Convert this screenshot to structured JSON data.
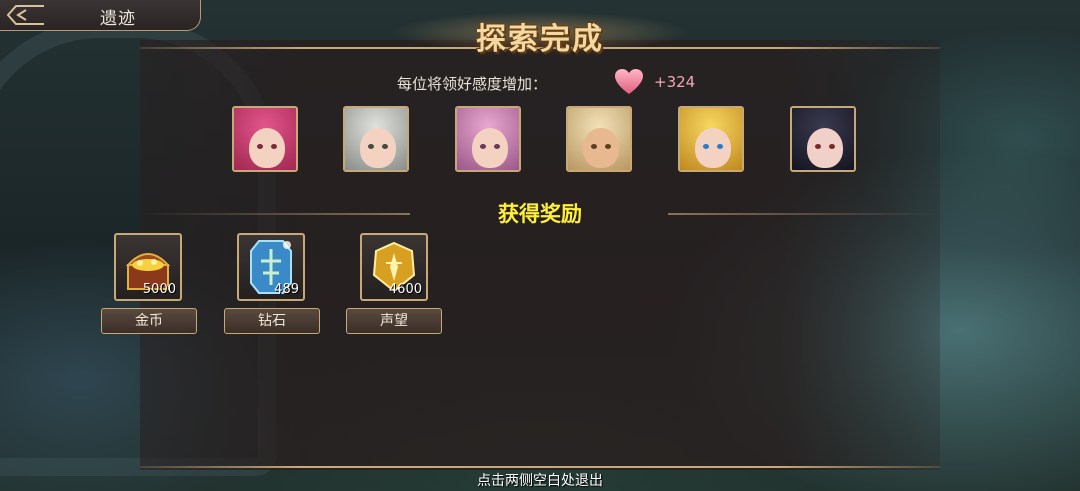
{
  "header": {
    "back_title": "遗迹",
    "title": "探索完成"
  },
  "affinity": {
    "label": "每位将领好感度增加：",
    "icon": "heart-icon",
    "value": "+324"
  },
  "portraits": [
    {
      "name": "portrait-1",
      "hair": "#e3558c",
      "eye": "#7a2a3a"
    },
    {
      "name": "portrait-2",
      "hair": "#c9ccc8",
      "eye": "#4a4a3a"
    },
    {
      "name": "portrait-3",
      "hair": "#d98fbf",
      "eye": "#6a3a5a"
    },
    {
      "name": "portrait-4",
      "hair": "#e8d2a0",
      "eye": "#5a4020"
    },
    {
      "name": "portrait-5",
      "hair": "#f0c040",
      "eye": "#2a7ac8"
    },
    {
      "name": "portrait-6",
      "hair": "#2a2a3a",
      "eye": "#7a2a2a"
    }
  ],
  "rewards_section": {
    "title": "获得奖励"
  },
  "rewards": [
    {
      "label": "金币",
      "count": "5000",
      "icon": "treasure-chest-icon"
    },
    {
      "label": "钻石",
      "count": "489",
      "icon": "diamond-crystal-icon"
    },
    {
      "label": "声望",
      "count": "4600",
      "icon": "prestige-medal-icon"
    }
  ],
  "footer": {
    "hint": "点击两侧空白处退出"
  },
  "colors": {
    "gold_border": "#c7a877",
    "section_title": "#ffef3a",
    "affinity_value": "#f2a6b6"
  }
}
